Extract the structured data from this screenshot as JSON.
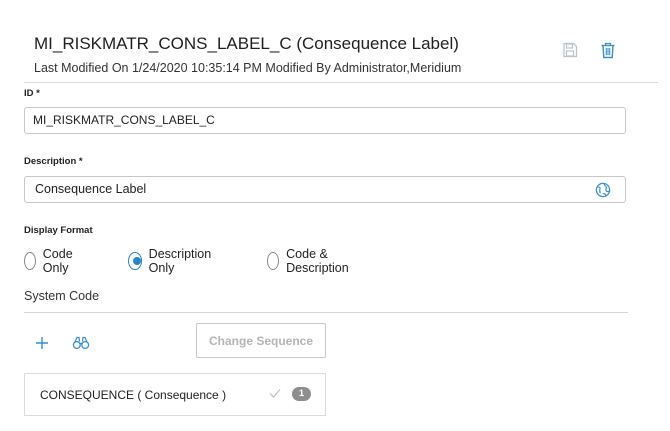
{
  "header": {
    "title": "MI_RISKMATR_CONS_LABEL_C (Consequence Label)",
    "subtitle": "Last Modified On 1/24/2020 10:35:14 PM Modified By Administrator,Meridium",
    "save_icon": "save-icon",
    "delete_icon": "trash-icon"
  },
  "form": {
    "id_label": "ID *",
    "id_value": "MI_RISKMATR_CONS_LABEL_C",
    "description_label": "Description *",
    "description_value": "Consequence Label",
    "display_format_label": "Display Format",
    "display_format_options": [
      {
        "label": "Code Only",
        "selected": false
      },
      {
        "label": "Description Only",
        "selected": true
      },
      {
        "label": "Code & Description",
        "selected": false
      }
    ]
  },
  "system_code": {
    "title": "System Code",
    "change_sequence_label": "Change Sequence",
    "items": [
      {
        "text": "CONSEQUENCE ( Consequence )",
        "count": "1"
      }
    ]
  },
  "colors": {
    "accent": "#2a84c6",
    "icon_blue": "#3a8fd0",
    "muted_icon": "#b9c3cc",
    "badge": "#8e8e8e"
  }
}
